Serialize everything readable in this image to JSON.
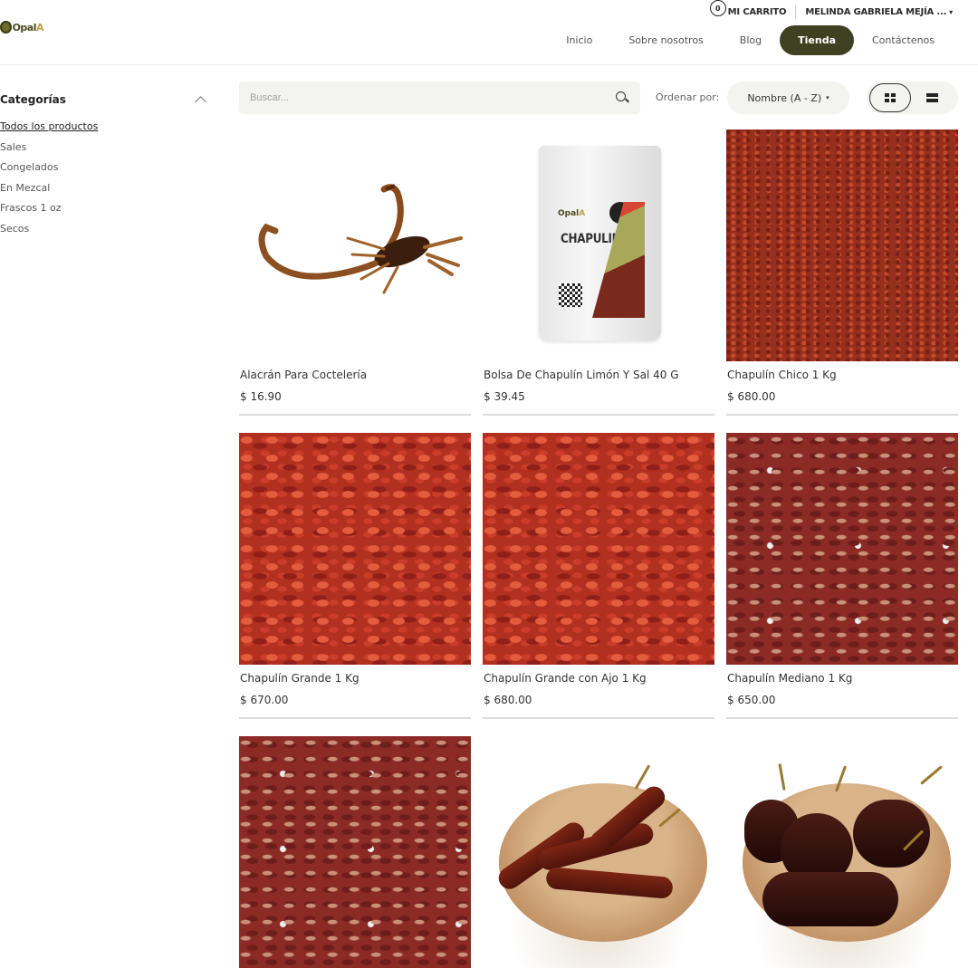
{
  "header": {
    "logo": {
      "text_a": "Opal",
      "text_b": "A",
      "icon": "logo-mark"
    },
    "cart": {
      "count": "0",
      "label": "MI CARRITO"
    },
    "user": {
      "name": "MELINDA GABRIELA MEJÍA ...",
      "caret": "▾"
    },
    "nav": [
      {
        "label": "Inicio"
      },
      {
        "label": "Sobre nosotros"
      },
      {
        "label": "Blog"
      },
      {
        "label": "Tienda",
        "active": true
      },
      {
        "label": "Contáctenos"
      }
    ],
    "accent_color": "#3f4222"
  },
  "sidebar": {
    "title": "Categorías",
    "items": [
      {
        "label": "Todos los productos",
        "active": true
      },
      {
        "label": "Sales"
      },
      {
        "label": "Congelados"
      },
      {
        "label": "En Mezcal"
      },
      {
        "label": "Frascos 1 oz"
      },
      {
        "label": "Secos"
      }
    ]
  },
  "toolbar": {
    "search_placeholder": "Buscar...",
    "sort_label": "Ordenar por:",
    "sort_value": "Nombre (A - Z)",
    "view_mode": "grid"
  },
  "products": [
    {
      "name": "Alacrán Para Coctelería",
      "price": "$ 16.90",
      "image": "scorpion"
    },
    {
      "name": "Bolsa De Chapulín Limón Y Sal 40 G",
      "price": "$ 39.45",
      "image": "chapulin-bag",
      "bag_text": "CHAPULIN"
    },
    {
      "name": "Chapulín Chico 1 Kg",
      "price": "$ 680.00",
      "image": "grasshoppers-small"
    },
    {
      "name": "Chapulín Grande 1 Kg",
      "price": "$ 670.00",
      "image": "grasshoppers-large"
    },
    {
      "name": "Chapulín Grande con Ajo 1 Kg",
      "price": "$ 680.00",
      "image": "grasshoppers-large"
    },
    {
      "name": "Chapulín Mediano 1 Kg",
      "price": "$ 650.00",
      "image": "grasshoppers-medium"
    },
    {
      "name": "",
      "price": "",
      "image": "grasshoppers-medium"
    },
    {
      "name": "",
      "price": "",
      "image": "dried-chili-bowl"
    },
    {
      "name": "",
      "price": "",
      "image": "dark-chili-bowl"
    }
  ]
}
